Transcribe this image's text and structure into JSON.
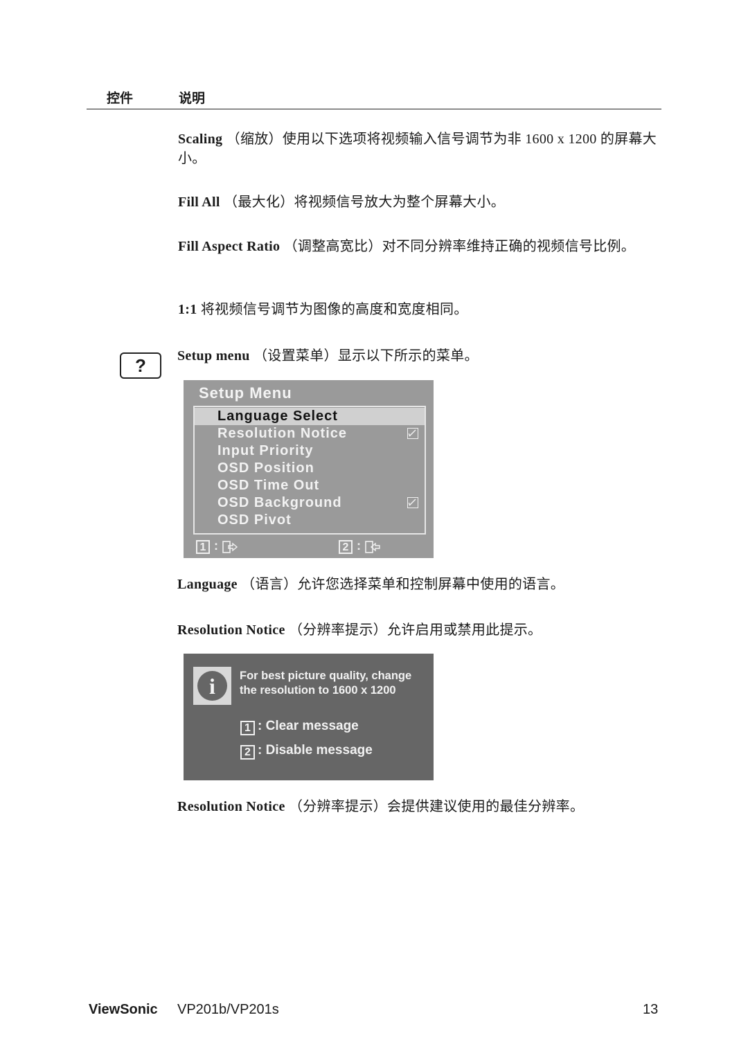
{
  "header": {
    "col_control": "控件",
    "col_description": "说明"
  },
  "sections": {
    "scaling": {
      "term": "Scaling",
      "text": " （缩放）使用以下选项将视频输入信号调节为非 1600 x  1200 的屏幕大小。"
    },
    "fill_all": {
      "term": "Fill All",
      "text": " （最大化）将视频信号放大为整个屏幕大小。"
    },
    "fill_aspect": {
      "term": "Fill Aspect Ratio",
      "text": " （调整高宽比）对不同分辨率维持正确的视频信号比例。"
    },
    "one_to_one": {
      "term": "1:1",
      "text": " 将视频信号调节为图像的高度和宽度相同。"
    },
    "setup_menu": {
      "icon": "help-question-icon",
      "icon_glyph": "?",
      "term": "Setup menu",
      "text": " （设置菜单）显示以下所示的菜单。"
    },
    "language": {
      "term": "Language",
      "text": " （语言）允许您选择菜单和控制屏幕中使用的语言。"
    },
    "resolution_notice_1": {
      "term": "Resolution Notice",
      "text": " （分辨率提示）允许启用或禁用此提示。"
    },
    "resolution_notice_2": {
      "term": "Resolution Notice",
      "text": " （分辨率提示）会提供建议使用的最佳分辨率。"
    }
  },
  "setup_osd": {
    "title": "Setup Menu",
    "items": [
      {
        "label": "Language Select",
        "selected": true,
        "checked": false
      },
      {
        "label": "Resolution Notice",
        "selected": false,
        "checked": true
      },
      {
        "label": "Input Priority",
        "selected": false,
        "checked": false
      },
      {
        "label": "OSD Position",
        "selected": false,
        "checked": false
      },
      {
        "label": "OSD Time Out",
        "selected": false,
        "checked": false
      },
      {
        "label": "OSD Background",
        "selected": false,
        "checked": true
      },
      {
        "label": "OSD Pivot",
        "selected": false,
        "checked": false
      }
    ],
    "footer": [
      {
        "key": "1",
        "sep": ":",
        "icon": "exit-door-icon"
      },
      {
        "key": "2",
        "sep": ":",
        "icon": "enter-door-icon"
      }
    ],
    "colors": {
      "panel": "#9a9a9a",
      "selected_row": "#d0d0d0",
      "text": "#f2f2f2"
    }
  },
  "notice_osd": {
    "icon": "info-icon",
    "icon_glyph": "i",
    "message_line1": "For best picture quality, change",
    "message_line2": "the resolution to 1600 x 1200",
    "options": [
      {
        "key": "1",
        "label": ": Clear message"
      },
      {
        "key": "2",
        "label": ": Disable message"
      }
    ],
    "colors": {
      "panel": "#666666",
      "icon_bg": "#d8d8d8"
    }
  },
  "footer": {
    "brand": "ViewSonic",
    "model": "VP201b/VP201s",
    "page_number": "13"
  }
}
